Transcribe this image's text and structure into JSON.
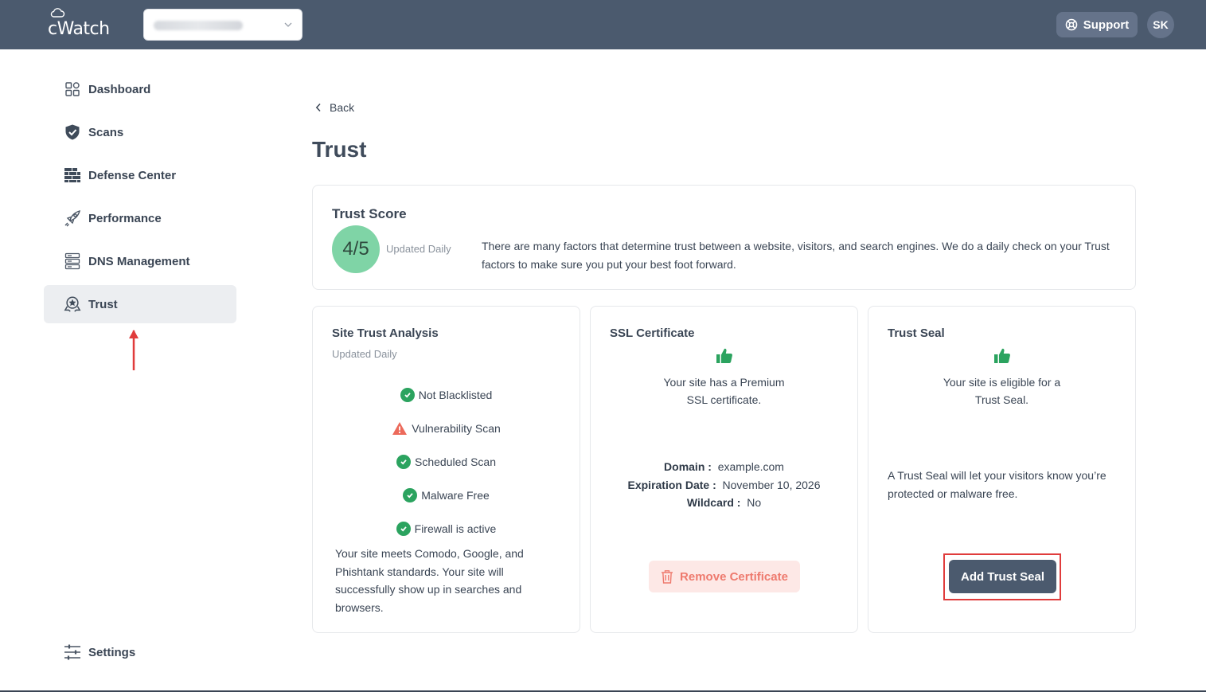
{
  "brand": {
    "logo_text": "cWatch"
  },
  "header": {
    "site_selector_value": "",
    "support_label": "Support",
    "avatar_initials": "SK"
  },
  "sidebar": {
    "items": [
      {
        "label": "Dashboard",
        "icon": "dashboard-icon"
      },
      {
        "label": "Scans",
        "icon": "shield-icon"
      },
      {
        "label": "Defense Center",
        "icon": "firewall-icon"
      },
      {
        "label": "Performance",
        "icon": "rocket-icon"
      },
      {
        "label": "DNS Management",
        "icon": "server-icon"
      },
      {
        "label": "Trust",
        "icon": "trust-badge-icon",
        "active": true
      }
    ],
    "settings_label": "Settings"
  },
  "main": {
    "back_label": "Back",
    "title": "Trust",
    "trust_score": {
      "title": "Trust Score",
      "score": "4/5",
      "updated": "Updated Daily",
      "description_line1": "There are many factors that determine trust between a website, visitors, and search engines. We do a daily check on your Trust",
      "description_line2": "factors to make sure you put your best foot forward."
    },
    "site_trust": {
      "title": "Site Trust Analysis",
      "updated": "Updated Daily",
      "checks": [
        {
          "label": "Not Blacklisted",
          "status": "ok"
        },
        {
          "label": "Vulnerability Scan",
          "status": "warning"
        },
        {
          "label": "Scheduled Scan",
          "status": "ok"
        },
        {
          "label": "Malware Free",
          "status": "ok"
        },
        {
          "label": "Firewall is active",
          "status": "ok"
        }
      ],
      "summary_lines": [
        "Your site meets Comodo, Google, and",
        "Phishtank standards. Your site will",
        "successfully show up in searches and",
        "browsers."
      ]
    },
    "ssl": {
      "title": "SSL Certificate",
      "message_line1": "Your site has a Premium",
      "message_line2": "SSL certificate.",
      "domain_label": "Domain :",
      "domain_value": "example.com",
      "expiration_label": "Expiration Date :",
      "expiration_value": "November 10, 2026",
      "wildcard_label": "Wildcard :",
      "wildcard_value": "No",
      "remove_label": "Remove Certificate"
    },
    "seal": {
      "title": "Trust Seal",
      "message_line1": "Your site is eligible for a",
      "message_line2": "Trust Seal.",
      "info_line1": "A Trust Seal will let your visitors know you’re",
      "info_line2": "protected or malware free.",
      "add_label": "Add Trust Seal"
    }
  },
  "colors": {
    "topbar": "#4b5a6e",
    "score_badge": "#7fd4a6",
    "ok_green": "#2ba35f",
    "warning": "#ec6a5b",
    "annotation_red": "#e03c3c"
  }
}
